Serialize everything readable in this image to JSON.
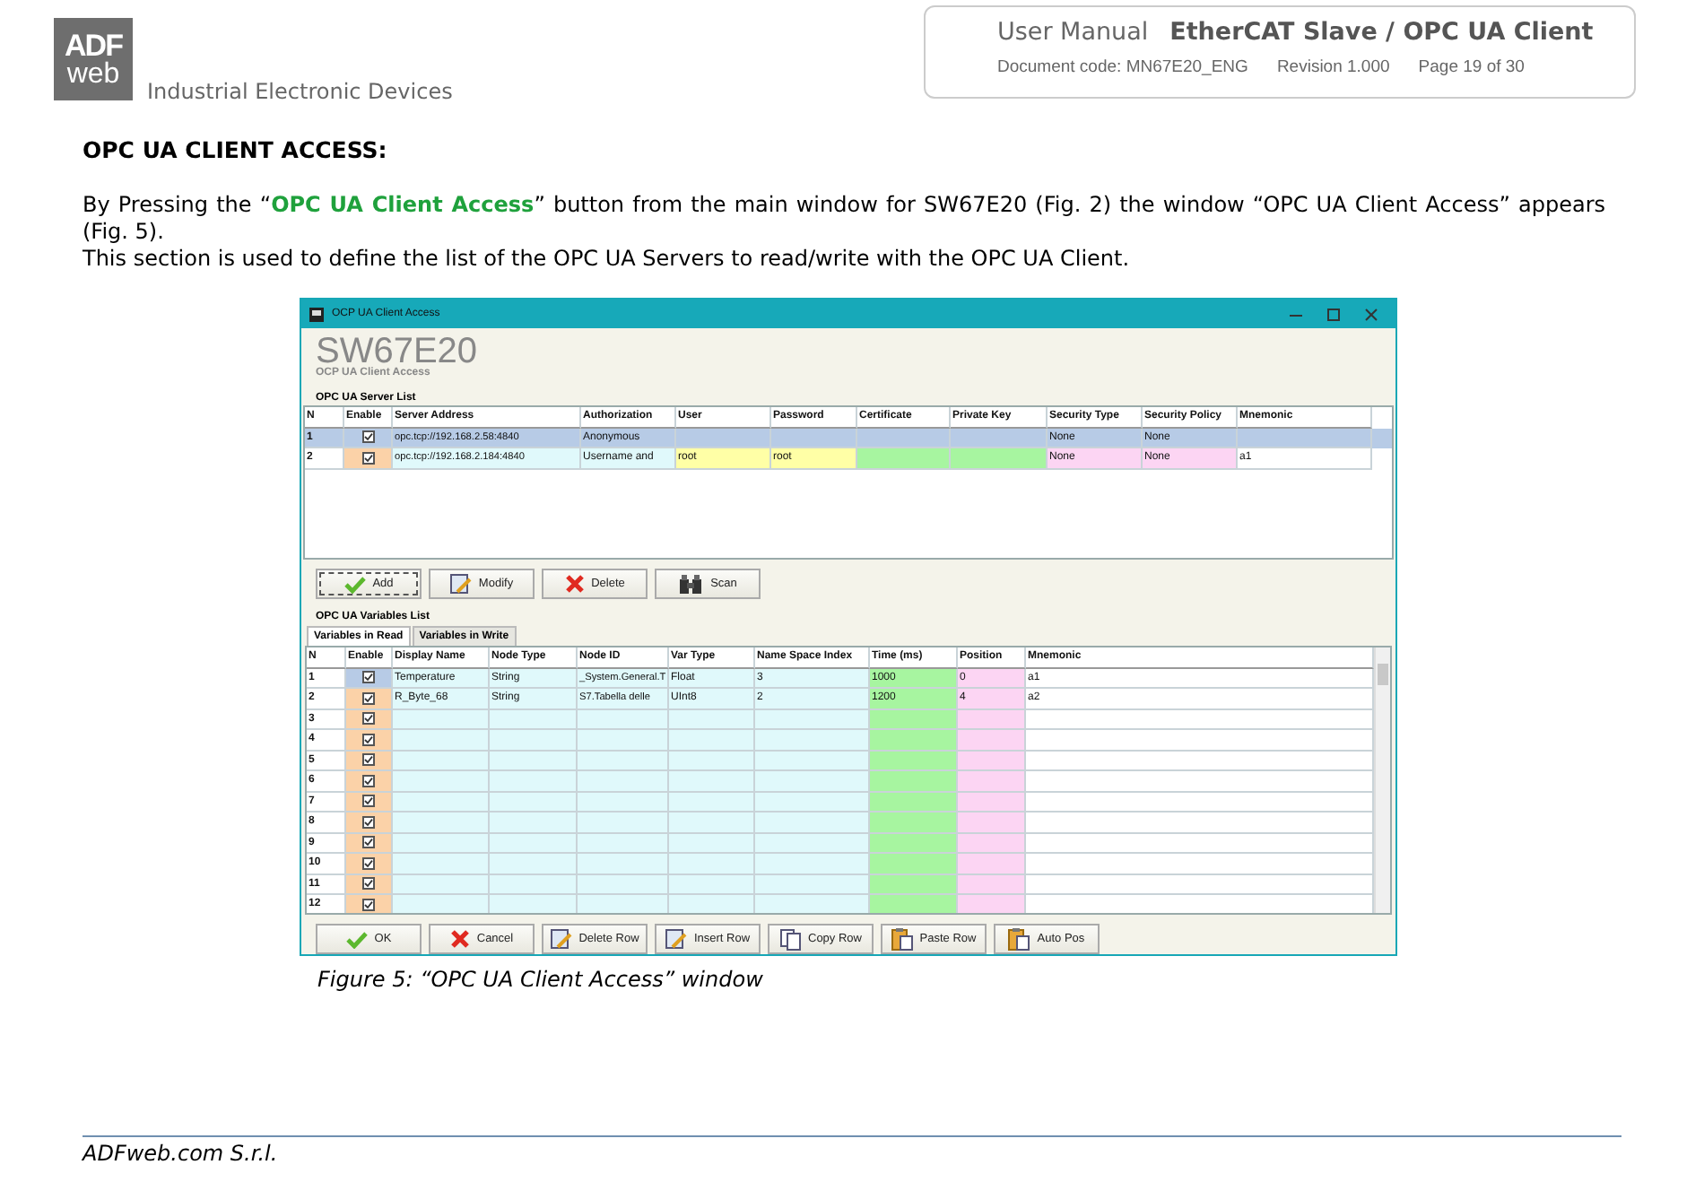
{
  "header": {
    "logo": {
      "top": "ADF",
      "bottom": "web"
    },
    "tagline": "Industrial Electronic Devices",
    "manual": "User Manual",
    "product": "EtherCAT Slave / OPC UA Client",
    "doc_code": "Document code: MN67E20_ENG",
    "revision": "Revision 1.000",
    "page": "Page 19 of 30"
  },
  "section_heading": "OPC UA CLIENT ACCESS:",
  "paragraphs": [
    {
      "segments": [
        {
          "kind": "plain",
          "text": "By Pressing the “"
        },
        {
          "kind": "highlight",
          "text": "OPC UA Client Access"
        },
        {
          "kind": "plain",
          "text": "” button from the main window for SW67E20 (Fig. 2) the window “OPC UA Client Access” appears (Fig. 5)."
        }
      ]
    },
    {
      "segments": [
        {
          "kind": "plain",
          "text": "This section is used to define the list of the OPC UA Servers to read/write with the OPC UA Client."
        }
      ]
    }
  ],
  "window": {
    "title": "OCP UA Client Access",
    "app_name": "SW67E20",
    "app_subtitle": "OCP UA Client Access",
    "server_list": {
      "label": "OPC UA Server List",
      "columns": [
        {
          "label": "N",
          "kind": "index"
        },
        {
          "label": "Enable",
          "kind": "check"
        },
        {
          "label": "Server Address",
          "kind": "text"
        },
        {
          "label": "Authorization",
          "kind": "text"
        },
        {
          "label": "User",
          "kind": "credential"
        },
        {
          "label": "Password",
          "kind": "credential"
        },
        {
          "label": "Certificate",
          "kind": "file"
        },
        {
          "label": "Private Key",
          "kind": "file"
        },
        {
          "label": "Security Type",
          "kind": "security"
        },
        {
          "label": "Security Policy",
          "kind": "security"
        },
        {
          "label": "Mnemonic",
          "kind": "plain"
        }
      ],
      "rows": [
        {
          "selected": true,
          "enabled": true,
          "cells": [
            "1",
            "",
            "opc.tcp://192.168.2.58:4840",
            "Anonymous",
            "",
            "",
            "",
            "",
            "None",
            "None",
            ""
          ]
        },
        {
          "selected": false,
          "enabled": true,
          "cells": [
            "2",
            "",
            "opc.tcp://192.168.2.184:4840",
            "Username and",
            "root",
            "root",
            "",
            "",
            "None",
            "None",
            "a1"
          ]
        }
      ]
    },
    "server_buttons": [
      {
        "label": "Add",
        "kind": "check",
        "focused": true
      },
      {
        "label": "Modify",
        "kind": "edit",
        "focused": false
      },
      {
        "label": "Delete",
        "kind": "cross",
        "focused": false
      },
      {
        "label": "Scan",
        "kind": "binoculars",
        "focused": false
      }
    ],
    "variables": {
      "label": "OPC UA Variables List",
      "tabs": [
        {
          "label": "Variables in Read",
          "selected": true
        },
        {
          "label": "Variables in Write",
          "selected": false
        }
      ],
      "columns": [
        {
          "label": "N",
          "kind": "index"
        },
        {
          "label": "Enable",
          "kind": "check"
        },
        {
          "label": "Display Name",
          "kind": "text"
        },
        {
          "label": "Node Type",
          "kind": "text"
        },
        {
          "label": "Node ID",
          "kind": "text"
        },
        {
          "label": "Var Type",
          "kind": "text"
        },
        {
          "label": "Name Space Index",
          "kind": "text"
        },
        {
          "label": "Time (ms)",
          "kind": "file"
        },
        {
          "label": "Position",
          "kind": "security"
        },
        {
          "label": "Mnemonic",
          "kind": "plain"
        }
      ],
      "rows": [
        {
          "selected": true,
          "enabled": true,
          "cells": [
            "1",
            "",
            "Temperature",
            "String",
            "_System.General.T",
            "Float",
            "3",
            "1000",
            "0",
            "a1"
          ]
        },
        {
          "selected": false,
          "enabled": true,
          "cells": [
            "2",
            "",
            "R_Byte_68",
            "String",
            "S7.Tabella delle",
            "UInt8",
            "2",
            "1200",
            "4",
            "a2"
          ]
        },
        {
          "selected": false,
          "enabled": true,
          "cells": [
            "3"
          ]
        },
        {
          "selected": false,
          "enabled": true,
          "cells": [
            "4"
          ]
        },
        {
          "selected": false,
          "enabled": true,
          "cells": [
            "5"
          ]
        },
        {
          "selected": false,
          "enabled": true,
          "cells": [
            "6"
          ]
        },
        {
          "selected": false,
          "enabled": true,
          "cells": [
            "7"
          ]
        },
        {
          "selected": false,
          "enabled": true,
          "cells": [
            "8"
          ]
        },
        {
          "selected": false,
          "enabled": true,
          "cells": [
            "9"
          ]
        },
        {
          "selected": false,
          "enabled": true,
          "cells": [
            "10"
          ]
        },
        {
          "selected": false,
          "enabled": true,
          "cells": [
            "11"
          ]
        },
        {
          "selected": false,
          "enabled": true,
          "cells": [
            "12"
          ]
        }
      ]
    },
    "bottom_buttons": [
      {
        "label": "OK",
        "kind": "check",
        "focused": false
      },
      {
        "label": "Cancel",
        "kind": "cross",
        "focused": false
      },
      {
        "label": "Delete Row",
        "kind": "edit",
        "focused": false
      },
      {
        "label": "Insert Row",
        "kind": "edit",
        "focused": false
      },
      {
        "label": "Copy Row",
        "kind": "copy",
        "focused": false
      },
      {
        "label": "Paste Row",
        "kind": "paste",
        "focused": false
      },
      {
        "label": "Auto Pos",
        "kind": "paste",
        "focused": false
      }
    ]
  },
  "caption": "Figure 5: “OPC UA Client Access” window",
  "footer": "ADFweb.com S.r.l."
}
